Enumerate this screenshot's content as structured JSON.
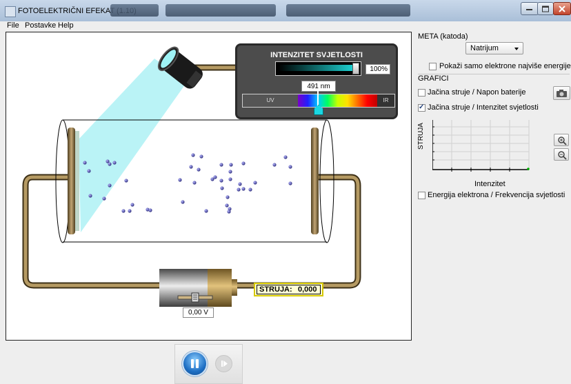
{
  "window": {
    "title": "FOTOELEKTRIČNI EFEKAT (1.10)"
  },
  "menu": [
    "File",
    "Postavke",
    "Help"
  ],
  "intensity_panel": {
    "title": "INTENZITET SVJETLOSTI",
    "intensity_value": "100%",
    "intensity_level": 1.0,
    "wavelength": "491 nm",
    "uv_label": "UV",
    "ir_label": "IR"
  },
  "circuit": {
    "current_label": "STRUJA:",
    "current_value": "0,000",
    "battery_voltage": "0,00 V",
    "battery_level": 0.5
  },
  "right_panel": {
    "target_label": "META (katoda)",
    "target_value": "Natrijum",
    "highest_energy_label": "Pokaži samo elektrone najviše energije",
    "highest_energy_checked": false,
    "graphs_label": "GRAFICI",
    "graph1_label": "Jačina struje / Napon baterije",
    "graph1_checked": false,
    "graph2_label": "Jačina struje / Intenzitet svjetlosti",
    "graph2_checked": true,
    "graph3_label": "Energija elektrona / Frekvencija svjetlosti",
    "graph3_checked": false,
    "chart_ylabel": "STRUJA",
    "chart_xlabel": "Intenzitet"
  },
  "controls": {
    "pause_icon": "pause-icon",
    "step_icon": "step-icon"
  }
}
